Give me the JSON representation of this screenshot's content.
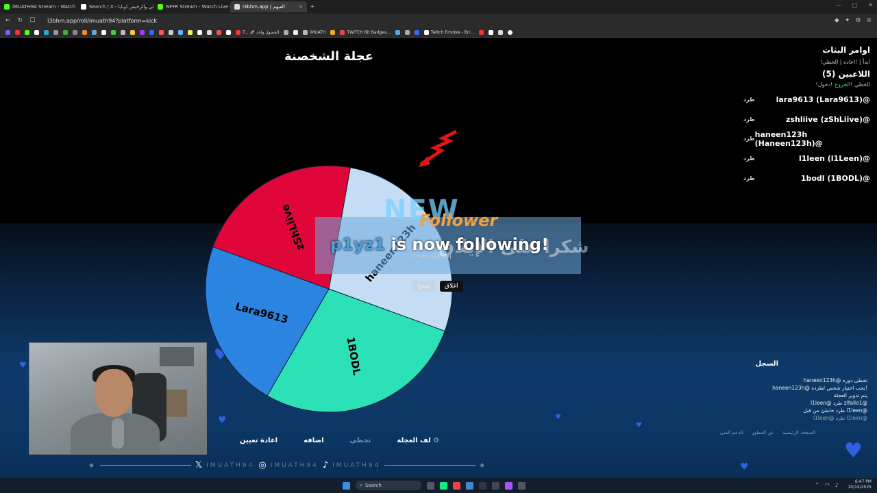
{
  "browser": {
    "tabs": [
      {
        "title": "iMUATH94 Stream - Watch Live o",
        "color": "#53fc18",
        "active": false
      },
      {
        "title": "Search / X - الغالي والرخيص اوبايا#",
        "color": "#ffffff",
        "active": false
      },
      {
        "title": "NFFR Stream - Watch Live on Kick",
        "color": "#53fc18",
        "active": false
      },
      {
        "title": "l3bhm.app | العبهم",
        "color": "#e5e5e5",
        "active": true
      }
    ],
    "new_tab": "+",
    "url": "l3bhm.app/roll/imuath94?platform=kick",
    "bookmarks": [
      "T... 🚀 الحصول واحد",
      "iMUATH",
      "TWITCH Bit Badges...",
      "Twitch Emotes - Bri..."
    ]
  },
  "page": {
    "title": "عجلة الشخصنة",
    "wheel": {
      "segments": [
        {
          "label": "haneen123h",
          "color": "#c5dcf5"
        },
        {
          "label": "1BODL",
          "color": "#2ce0b8"
        },
        {
          "label": "Lara9613",
          "color": "#2b84e0"
        },
        {
          "label": "zShLiive",
          "color": "#e0063a"
        }
      ]
    },
    "overlay": {
      "new": "NEW",
      "follower": "Follower",
      "username": "p1yz1",
      "message": "is now following!",
      "thanks": "شكرا على الإيلاق",
      "winner_line": "l1mee (l1mee)",
      "close_label": "اغلاق",
      "clear_label": "مسح"
    },
    "sidebar": {
      "commands_title": "اوامر البثات",
      "commands": "!ابدأ | !اعاده | الخطي",
      "players_title": "اللاعبين (5)",
      "mini_left": "!الخطي",
      "mini_exit": "!الخروج",
      "mini_right": "!دخول",
      "players": [
        {
          "name": "lara9613 (Lara9613)@",
          "kick": "طرد"
        },
        {
          "name": "zshliive (zShLiive)@",
          "kick": "طرد"
        },
        {
          "name": "haneen123h (Haneen123h)@",
          "kick": "طرد"
        },
        {
          "name": "l1leen (l1Leen)@",
          "kick": "طرد"
        },
        {
          "name": "1bodl (1BODL)@",
          "kick": "طرد"
        }
      ]
    },
    "log": {
      "title": "السجل",
      "entries": [
        "haneen123h@ تخطى دوره",
        "haneen123h@ يجب اختيار شخص لطرده!",
        "يتم تدوير العجلة",
        "l1leen@ طرد zlfallo1@",
        "طرد خاطئ من قبل l1leen@",
        "l1leen@ طرد l1leen@"
      ]
    },
    "footer_links": [
      "الصفحة الرئيسية",
      "عن المطور",
      "الدعم الفني"
    ],
    "controls": {
      "reassign": "اعادة تعيين",
      "add": "اضافه",
      "skip": "تخطي",
      "spin": "لف العجلة"
    },
    "social": {
      "handle1": "IMUATH94",
      "handle2": "IMUATH94",
      "handle3": "IMUATH94"
    }
  },
  "taskbar": {
    "search_placeholder": "Search",
    "time": "6:47 PM",
    "date": "10/14/2025"
  }
}
